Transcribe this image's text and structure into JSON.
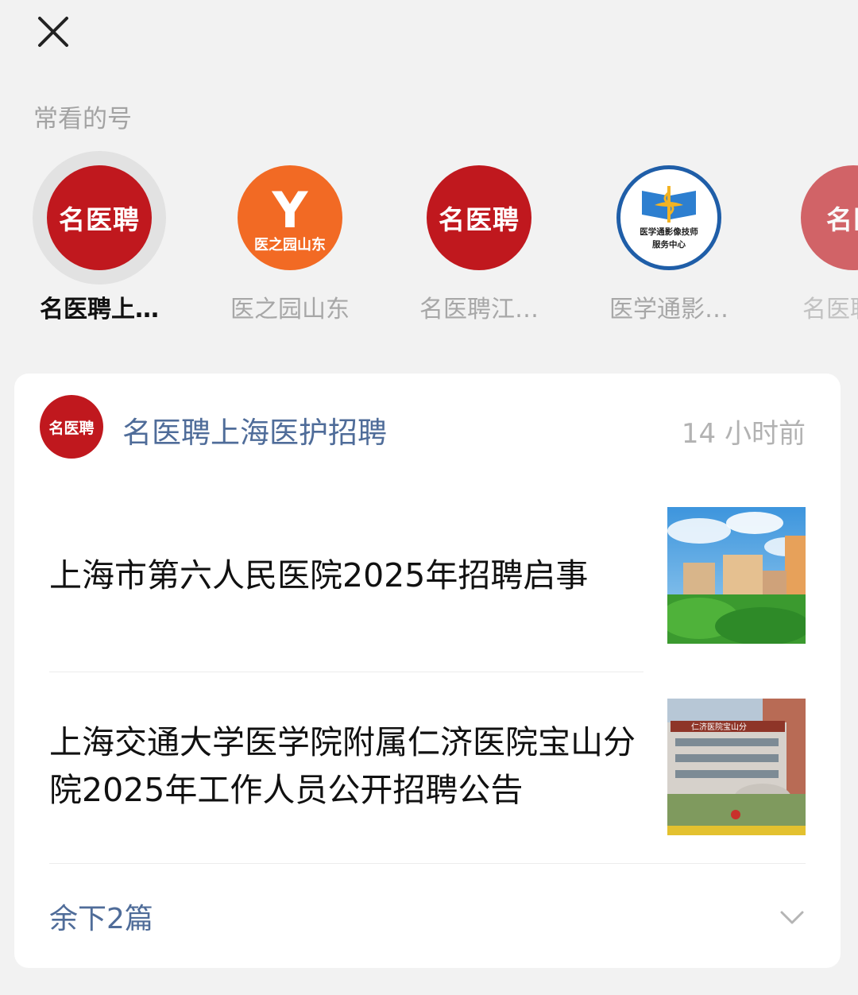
{
  "header": {
    "close_icon": "close-icon"
  },
  "frequent": {
    "title": "常看的号",
    "accounts": [
      {
        "name": "名医聘上…",
        "logo": "名医聘",
        "selected": true
      },
      {
        "name": "医之园山东",
        "logo": "Y",
        "logo_sub": "医之园山东"
      },
      {
        "name": "名医聘江…",
        "logo": "名医聘"
      },
      {
        "name": "医学通影…",
        "logo_line1": "医学通影像技师",
        "logo_line2": "服务中心"
      },
      {
        "name": "名医聘",
        "logo": "名医"
      }
    ]
  },
  "card": {
    "source_logo": "名医聘",
    "source_name": "名医聘上海医护招聘",
    "time": "14 小时前",
    "articles": [
      {
        "title": "上海市第六人民医院2025年招聘启事",
        "thumb": "hospital-aerial-photo"
      },
      {
        "title": "上海交通大学医学院附属仁济医院宝山分院2025年工作人员公开招聘公告",
        "thumb": "hospital-building-photo",
        "thumb_sign": "仁济医院宝山分"
      }
    ],
    "more_label": "余下2篇",
    "more_icon": "chevron-down-icon"
  },
  "colors": {
    "brand_red": "#c0181e",
    "link_blue": "#4f6c99",
    "orange": "#f26a24"
  }
}
